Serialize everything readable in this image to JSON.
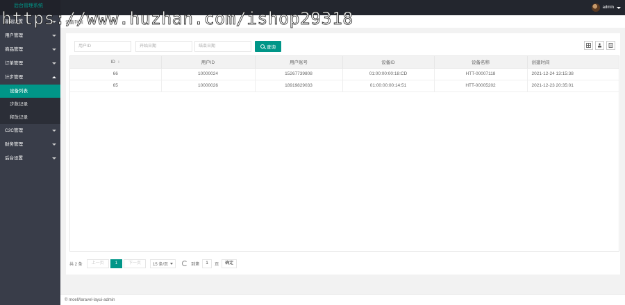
{
  "app": {
    "title": "后台管理系统"
  },
  "user": {
    "name": "admin"
  },
  "sidebar": {
    "items": [
      {
        "label": "基础设置"
      },
      {
        "label": "用户管理"
      },
      {
        "label": "商品管理"
      },
      {
        "label": "订单管理"
      },
      {
        "label": "计步管理"
      },
      {
        "label": "C2C管理"
      },
      {
        "label": "财务管理"
      },
      {
        "label": "后台设置"
      }
    ],
    "sub_items": [
      {
        "label": "设备列表"
      },
      {
        "label": "步数记录"
      },
      {
        "label": "释放记录"
      }
    ]
  },
  "tab": {
    "label": "设备列表"
  },
  "filters": {
    "user_id_placeholder": "用户ID",
    "start_date_placeholder": "开始日期",
    "end_date_placeholder": "结束日期",
    "search_label": "查询"
  },
  "toolbar": {
    "filter_icon": "columns-icon",
    "export_icon": "export-icon",
    "print_icon": "print-icon"
  },
  "table": {
    "headers": [
      "ID",
      "用户ID",
      "用户账号",
      "设备ID",
      "设备名称",
      "创建时间"
    ],
    "rows": [
      [
        "66",
        "10000024",
        "15267739808",
        "01:00:00:00:18:CD",
        "HTT-00007118",
        "2021-12-24 13:15:38"
      ],
      [
        "65",
        "10000026",
        "18919829033",
        "01:00:00:00:14:51",
        "HTT-00005202",
        "2021-12-23 20:35:01"
      ]
    ]
  },
  "pagination": {
    "total": "共 2 条",
    "prev": "上一页",
    "current": "1",
    "next": "下一页",
    "per_page": "15 条/页",
    "goto_label": "到第",
    "goto_value": "1",
    "page_suffix": "页",
    "confirm": "确定"
  },
  "footer": {
    "text": "© moell/laravel-layui-admin"
  },
  "watermark": {
    "text": "https://www.huzhan.com/ishop29318"
  },
  "colors": {
    "accent": "#009688",
    "sidebar": "#393d49",
    "topbar": "#23262e"
  }
}
